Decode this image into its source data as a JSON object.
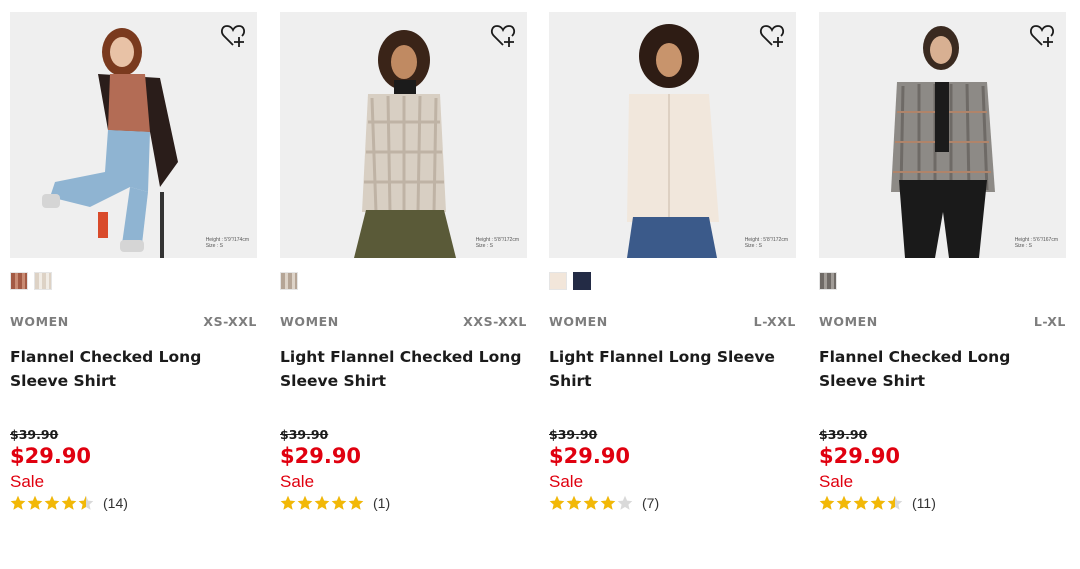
{
  "products": [
    {
      "photo_alt": "",
      "model_info": [
        "Height : 5'9\"/174cm",
        "Size : S"
      ],
      "swatches": [
        "#b0705a",
        "#e6ddd2"
      ],
      "gender": "WOMEN",
      "sizes": "XS-XXL",
      "title": "Flannel Checked Long Sleeve Shirt",
      "original_price": "$39.90",
      "sale_price": "$29.90",
      "sale_label": "Sale",
      "rating": 4.5,
      "review_count": "(14)"
    },
    {
      "photo_alt": "",
      "model_info": [
        "Height : 5'8\"/172cm",
        "Size : S"
      ],
      "swatches": [
        "#c7b8ab"
      ],
      "gender": "WOMEN",
      "sizes": "XXS-XXL",
      "title": "Light Flannel Checked Long Sleeve Shirt",
      "original_price": "$39.90",
      "sale_price": "$29.90",
      "sale_label": "Sale",
      "rating": 5,
      "review_count": "(1)"
    },
    {
      "photo_alt": "",
      "model_info": [
        "Height : 5'8\"/172cm",
        "Size : S"
      ],
      "swatches": [
        "#f2e6da",
        "#232b45"
      ],
      "gender": "WOMEN",
      "sizes": "L-XXL",
      "title": "Light Flannel Long Sleeve Shirt",
      "original_price": "$39.90",
      "sale_price": "$29.90",
      "sale_label": "Sale",
      "rating": 4,
      "review_count": "(7)"
    },
    {
      "photo_alt": "",
      "model_info": [
        "Height : 5'6\"/167cm",
        "Size : S"
      ],
      "swatches": [
        "#8a8580"
      ],
      "gender": "WOMEN",
      "sizes": "L-XL",
      "title": "Flannel Checked Long Sleeve Shirt",
      "original_price": "$39.90",
      "sale_price": "$29.90",
      "sale_label": "Sale",
      "rating": 4.5,
      "review_count": "(11)"
    }
  ],
  "icons": {
    "favorite": "heart-plus-icon",
    "star": "star-icon"
  },
  "colors": {
    "sale": "#e0000f",
    "star": "#f2b807",
    "star_empty": "#d9d9d9",
    "image_bg": "#efefef"
  }
}
